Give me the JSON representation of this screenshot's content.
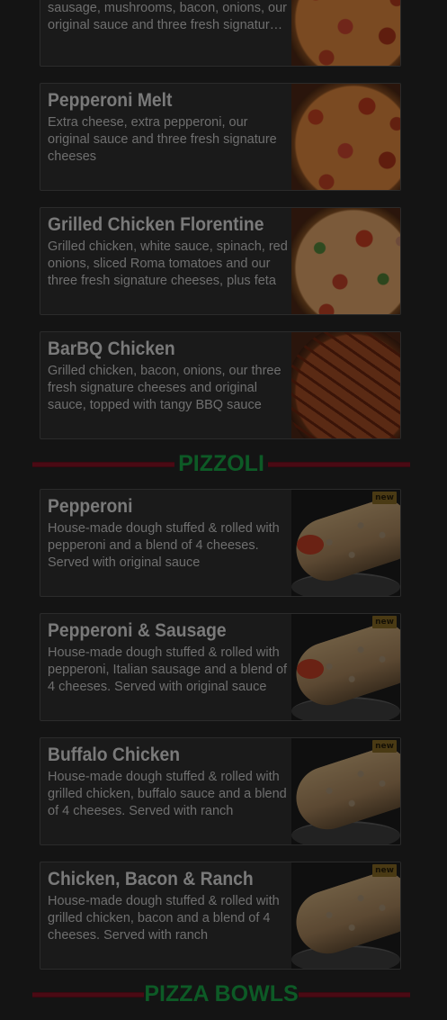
{
  "colors": {
    "background": "#141414",
    "card_background": "#1a1a1a",
    "section_heading": "#0d5a26",
    "divider": "#4a0a14",
    "badge": "#4a3a14"
  },
  "pizzas_top": [
    {
      "title": "",
      "description": "Pepperoni, ham, green peppers, Italian sausage, mushrooms, bacon, onions, our original sauce and three fresh signatur…",
      "image_icon": "pizza-photo"
    },
    {
      "title": "Pepperoni Melt",
      "description": "Extra cheese, extra pepperoni, our original sauce and three fresh signature cheeses",
      "image_icon": "pizza-photo"
    },
    {
      "title": "Grilled Chicken Florentine",
      "description": "Grilled chicken, white sauce, spinach, red onions, sliced Roma tomatoes and our three fresh signature cheeses, plus feta",
      "image_icon": "pizza-photo"
    },
    {
      "title": "BarBQ Chicken",
      "description": "Grilled chicken, bacon, onions, our three fresh signature cheeses and original sauce, topped with tangy BBQ sauce",
      "image_icon": "pizza-photo"
    }
  ],
  "sections": {
    "pizzoli": "PIZZOLI",
    "pizza_bowls": "PIZZA BOWLS"
  },
  "pizzoli": [
    {
      "title": "Pepperoni",
      "description": "House-made dough stuffed & rolled with pepperoni and a blend of 4 cheeses. Served with original sauce",
      "badge": "new",
      "image_icon": "pizzoli-photo"
    },
    {
      "title": "Pepperoni & Sausage",
      "description": "House-made dough stuffed & rolled with pepperoni, Italian sausage and a blend of 4 cheeses. Served with original sauce",
      "badge": "new",
      "image_icon": "pizzoli-photo"
    },
    {
      "title": "Buffalo Chicken",
      "description": "House-made dough stuffed & rolled with grilled chicken, buffalo sauce and a blend of 4 cheeses. Served with ranch",
      "badge": "new",
      "image_icon": "pizzoli-photo"
    },
    {
      "title": "Chicken, Bacon & Ranch",
      "description": "House-made dough stuffed & rolled with grilled chicken, bacon and a blend of 4 cheeses. Served with ranch",
      "badge": "new",
      "image_icon": "pizzoli-photo"
    }
  ]
}
